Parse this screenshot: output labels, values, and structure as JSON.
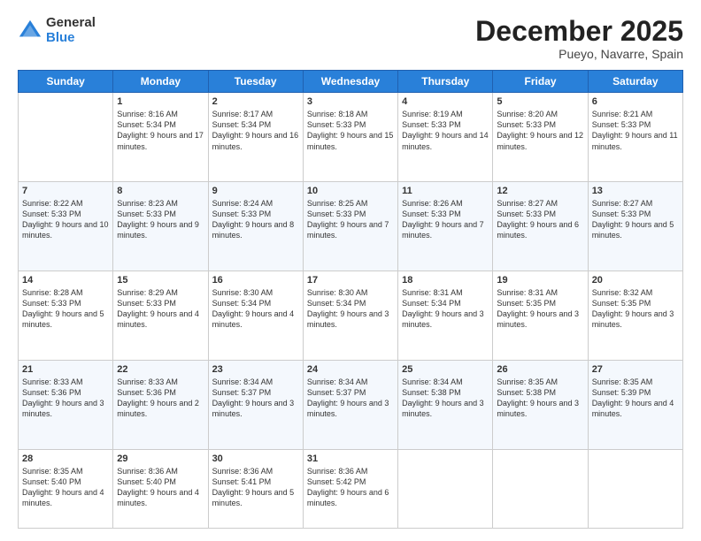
{
  "logo": {
    "general": "General",
    "blue": "Blue"
  },
  "header": {
    "month": "December 2025",
    "location": "Pueyo, Navarre, Spain"
  },
  "weekdays": [
    "Sunday",
    "Monday",
    "Tuesday",
    "Wednesday",
    "Thursday",
    "Friday",
    "Saturday"
  ],
  "weeks": [
    [
      {
        "day": "",
        "sunrise": "",
        "sunset": "",
        "daylight": ""
      },
      {
        "day": "1",
        "sunrise": "Sunrise: 8:16 AM",
        "sunset": "Sunset: 5:34 PM",
        "daylight": "Daylight: 9 hours and 17 minutes."
      },
      {
        "day": "2",
        "sunrise": "Sunrise: 8:17 AM",
        "sunset": "Sunset: 5:34 PM",
        "daylight": "Daylight: 9 hours and 16 minutes."
      },
      {
        "day": "3",
        "sunrise": "Sunrise: 8:18 AM",
        "sunset": "Sunset: 5:33 PM",
        "daylight": "Daylight: 9 hours and 15 minutes."
      },
      {
        "day": "4",
        "sunrise": "Sunrise: 8:19 AM",
        "sunset": "Sunset: 5:33 PM",
        "daylight": "Daylight: 9 hours and 14 minutes."
      },
      {
        "day": "5",
        "sunrise": "Sunrise: 8:20 AM",
        "sunset": "Sunset: 5:33 PM",
        "daylight": "Daylight: 9 hours and 12 minutes."
      },
      {
        "day": "6",
        "sunrise": "Sunrise: 8:21 AM",
        "sunset": "Sunset: 5:33 PM",
        "daylight": "Daylight: 9 hours and 11 minutes."
      }
    ],
    [
      {
        "day": "7",
        "sunrise": "Sunrise: 8:22 AM",
        "sunset": "Sunset: 5:33 PM",
        "daylight": "Daylight: 9 hours and 10 minutes."
      },
      {
        "day": "8",
        "sunrise": "Sunrise: 8:23 AM",
        "sunset": "Sunset: 5:33 PM",
        "daylight": "Daylight: 9 hours and 9 minutes."
      },
      {
        "day": "9",
        "sunrise": "Sunrise: 8:24 AM",
        "sunset": "Sunset: 5:33 PM",
        "daylight": "Daylight: 9 hours and 8 minutes."
      },
      {
        "day": "10",
        "sunrise": "Sunrise: 8:25 AM",
        "sunset": "Sunset: 5:33 PM",
        "daylight": "Daylight: 9 hours and 7 minutes."
      },
      {
        "day": "11",
        "sunrise": "Sunrise: 8:26 AM",
        "sunset": "Sunset: 5:33 PM",
        "daylight": "Daylight: 9 hours and 7 minutes."
      },
      {
        "day": "12",
        "sunrise": "Sunrise: 8:27 AM",
        "sunset": "Sunset: 5:33 PM",
        "daylight": "Daylight: 9 hours and 6 minutes."
      },
      {
        "day": "13",
        "sunrise": "Sunrise: 8:27 AM",
        "sunset": "Sunset: 5:33 PM",
        "daylight": "Daylight: 9 hours and 5 minutes."
      }
    ],
    [
      {
        "day": "14",
        "sunrise": "Sunrise: 8:28 AM",
        "sunset": "Sunset: 5:33 PM",
        "daylight": "Daylight: 9 hours and 5 minutes."
      },
      {
        "day": "15",
        "sunrise": "Sunrise: 8:29 AM",
        "sunset": "Sunset: 5:33 PM",
        "daylight": "Daylight: 9 hours and 4 minutes."
      },
      {
        "day": "16",
        "sunrise": "Sunrise: 8:30 AM",
        "sunset": "Sunset: 5:34 PM",
        "daylight": "Daylight: 9 hours and 4 minutes."
      },
      {
        "day": "17",
        "sunrise": "Sunrise: 8:30 AM",
        "sunset": "Sunset: 5:34 PM",
        "daylight": "Daylight: 9 hours and 3 minutes."
      },
      {
        "day": "18",
        "sunrise": "Sunrise: 8:31 AM",
        "sunset": "Sunset: 5:34 PM",
        "daylight": "Daylight: 9 hours and 3 minutes."
      },
      {
        "day": "19",
        "sunrise": "Sunrise: 8:31 AM",
        "sunset": "Sunset: 5:35 PM",
        "daylight": "Daylight: 9 hours and 3 minutes."
      },
      {
        "day": "20",
        "sunrise": "Sunrise: 8:32 AM",
        "sunset": "Sunset: 5:35 PM",
        "daylight": "Daylight: 9 hours and 3 minutes."
      }
    ],
    [
      {
        "day": "21",
        "sunrise": "Sunrise: 8:33 AM",
        "sunset": "Sunset: 5:36 PM",
        "daylight": "Daylight: 9 hours and 3 minutes."
      },
      {
        "day": "22",
        "sunrise": "Sunrise: 8:33 AM",
        "sunset": "Sunset: 5:36 PM",
        "daylight": "Daylight: 9 hours and 2 minutes."
      },
      {
        "day": "23",
        "sunrise": "Sunrise: 8:34 AM",
        "sunset": "Sunset: 5:37 PM",
        "daylight": "Daylight: 9 hours and 3 minutes."
      },
      {
        "day": "24",
        "sunrise": "Sunrise: 8:34 AM",
        "sunset": "Sunset: 5:37 PM",
        "daylight": "Daylight: 9 hours and 3 minutes."
      },
      {
        "day": "25",
        "sunrise": "Sunrise: 8:34 AM",
        "sunset": "Sunset: 5:38 PM",
        "daylight": "Daylight: 9 hours and 3 minutes."
      },
      {
        "day": "26",
        "sunrise": "Sunrise: 8:35 AM",
        "sunset": "Sunset: 5:38 PM",
        "daylight": "Daylight: 9 hours and 3 minutes."
      },
      {
        "day": "27",
        "sunrise": "Sunrise: 8:35 AM",
        "sunset": "Sunset: 5:39 PM",
        "daylight": "Daylight: 9 hours and 4 minutes."
      }
    ],
    [
      {
        "day": "28",
        "sunrise": "Sunrise: 8:35 AM",
        "sunset": "Sunset: 5:40 PM",
        "daylight": "Daylight: 9 hours and 4 minutes."
      },
      {
        "day": "29",
        "sunrise": "Sunrise: 8:36 AM",
        "sunset": "Sunset: 5:40 PM",
        "daylight": "Daylight: 9 hours and 4 minutes."
      },
      {
        "day": "30",
        "sunrise": "Sunrise: 8:36 AM",
        "sunset": "Sunset: 5:41 PM",
        "daylight": "Daylight: 9 hours and 5 minutes."
      },
      {
        "day": "31",
        "sunrise": "Sunrise: 8:36 AM",
        "sunset": "Sunset: 5:42 PM",
        "daylight": "Daylight: 9 hours and 6 minutes."
      },
      {
        "day": "",
        "sunrise": "",
        "sunset": "",
        "daylight": ""
      },
      {
        "day": "",
        "sunrise": "",
        "sunset": "",
        "daylight": ""
      },
      {
        "day": "",
        "sunrise": "",
        "sunset": "",
        "daylight": ""
      }
    ]
  ]
}
